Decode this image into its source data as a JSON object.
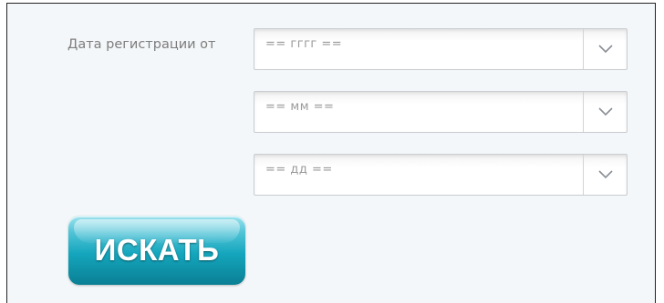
{
  "form": {
    "label": "Дата регистрации от",
    "year_select": {
      "value": "== гггг =="
    },
    "month_select": {
      "value": "== мм =="
    },
    "day_select": {
      "value": "== дд =="
    },
    "search_button": "ИСКАТЬ"
  },
  "colors": {
    "background": "#f4f7f9",
    "button_accent": "#14a6bd"
  },
  "icons": {
    "dropdown": "chevron-down-icon"
  }
}
